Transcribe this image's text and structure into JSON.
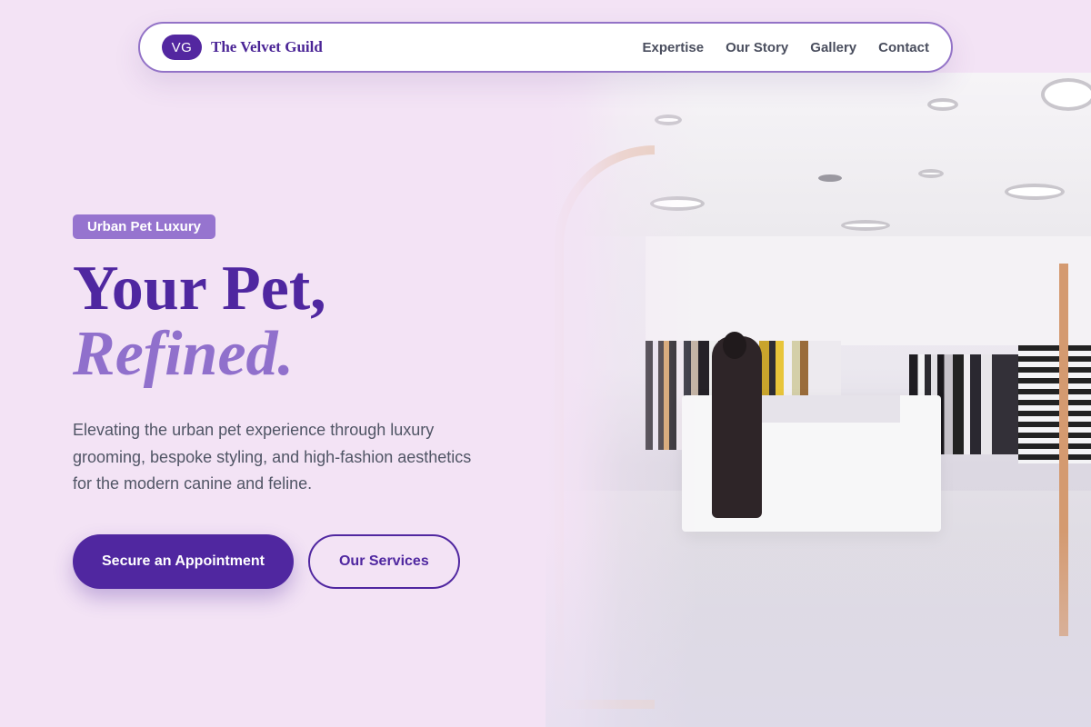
{
  "nav": {
    "logo_initials": "VG",
    "brand_name": "The Velvet Guild",
    "links": [
      "Expertise",
      "Our Story",
      "Gallery",
      "Contact"
    ]
  },
  "hero": {
    "tag": "Urban Pet Luxury",
    "headline_line1": "Your Pet,",
    "headline_line2": "Refined.",
    "subtext": "Elevating the urban pet experience through luxury grooming, bespoke styling, and high-fashion aesthetics for the modern canine and feline.",
    "primary_cta": "Secure an Appointment",
    "secondary_cta": "Our Services",
    "image_alt": "Boutique store interior"
  },
  "colors": {
    "background": "#f3e3f5",
    "brand_primary": "#5027a0",
    "brand_light": "#9674cf",
    "text_body": "#505565"
  },
  "icons": {
    "logo": "vg-monogram-icon"
  }
}
